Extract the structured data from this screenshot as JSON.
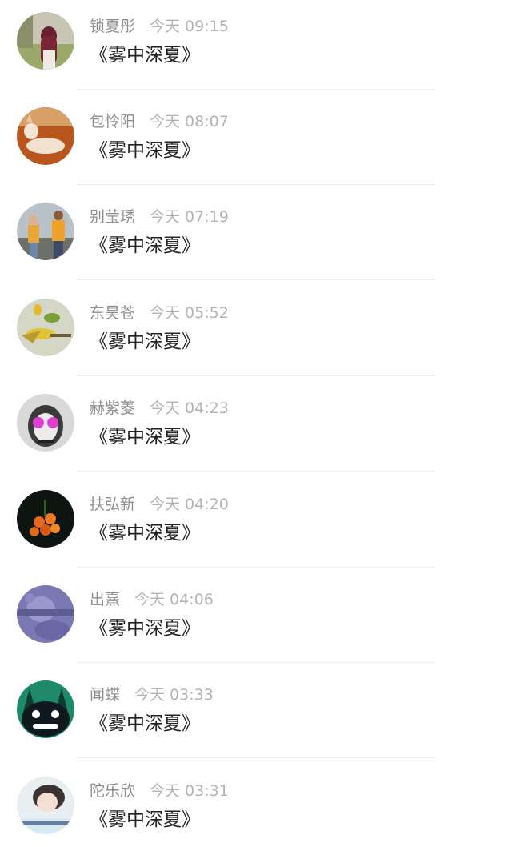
{
  "messages": [
    {
      "name": "锁夏彤",
      "time": "今天 09:15",
      "text": "《雾中深夏》",
      "avatar": "girl-red-hair-avatar"
    },
    {
      "name": "包怜阳",
      "time": "今天 08:07",
      "text": "《雾中深夏》",
      "avatar": "dog-avatar"
    },
    {
      "name": "别莹琇",
      "time": "今天 07:19",
      "text": "《雾中深夏》",
      "avatar": "couple-avatar"
    },
    {
      "name": "东昊苍",
      "time": "今天 05:52",
      "text": "《雾中深夏》",
      "avatar": "birds-avatar"
    },
    {
      "name": "赫紫菱",
      "time": "今天 04:23",
      "text": "《雾中深夏》",
      "avatar": "sunglasses-girl-avatar"
    },
    {
      "name": "扶弘新",
      "time": "今天 04:20",
      "text": "《雾中深夏》",
      "avatar": "orange-flowers-avatar"
    },
    {
      "name": "出熹",
      "time": "今天 04:06",
      "text": "《雾中深夏》",
      "avatar": "purple-bear-avatar"
    },
    {
      "name": "闻蝶",
      "time": "今天 03:33",
      "text": "《雾中深夏》",
      "avatar": "totoro-avatar"
    },
    {
      "name": "陀乐欣",
      "time": "今天 03:31",
      "text": "《雾中深夏》",
      "avatar": "cartoon-girl-avatar"
    }
  ],
  "colors": {
    "name": "#8e8e8e",
    "time": "#b3b3b3",
    "message": "#222222",
    "divider": "#efefef",
    "background": "#ffffff"
  }
}
